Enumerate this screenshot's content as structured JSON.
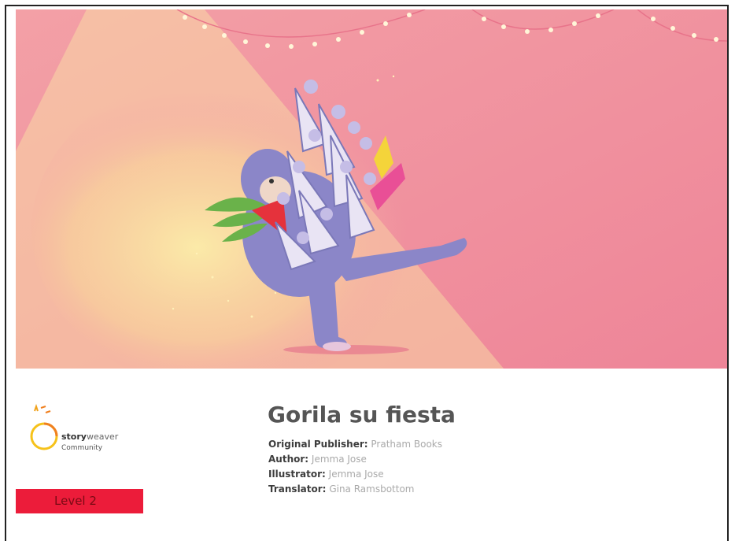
{
  "book": {
    "title": "Gorila su fiesta",
    "credits": [
      {
        "label": "Original Publisher:",
        "value": "Pratham Books"
      },
      {
        "label": "Author:",
        "value": "Jemma Jose"
      },
      {
        "label": "Illustrator:",
        "value": "Jemma Jose"
      },
      {
        "label": "Translator:",
        "value": "Gina Ramsbottom"
      }
    ]
  },
  "brand": {
    "name_bold": "story",
    "name_light": "weaver",
    "subtitle": "Community"
  },
  "level": {
    "label": "Level 2",
    "color": "#ec1c3a"
  },
  "colors": {
    "cover_background": "#f08a9c",
    "spotlight": "#f9e4a4",
    "gorilla": "#8b86c8",
    "level_badge": "#ec1c3a"
  },
  "cover": {
    "illustration": "dancing gorilla holding party hats and gifts under string lights"
  }
}
